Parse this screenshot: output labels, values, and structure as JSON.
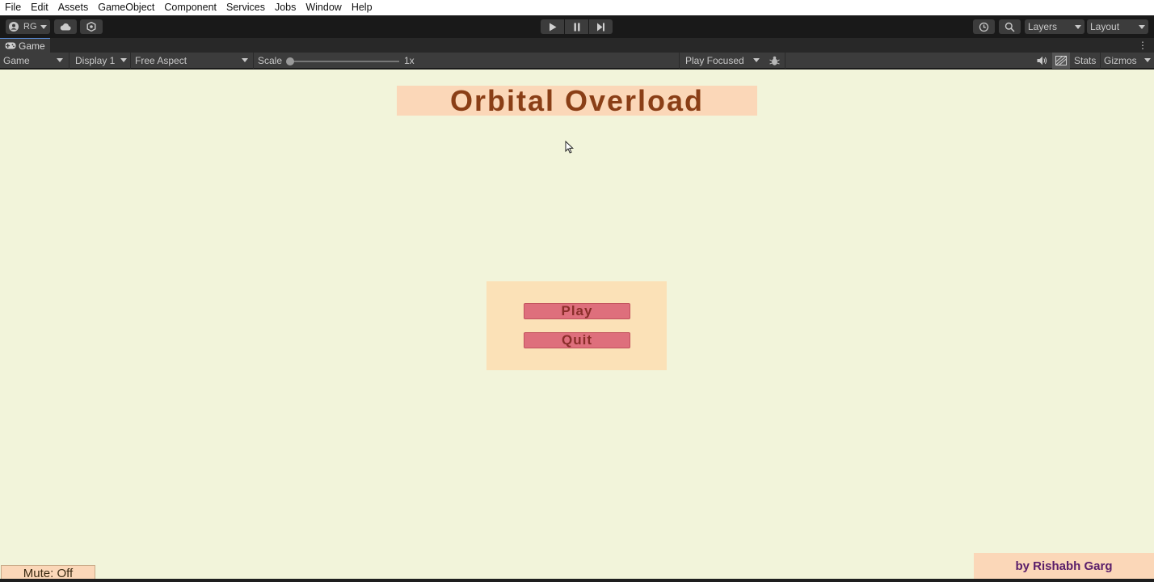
{
  "menu": {
    "items": [
      "File",
      "Edit",
      "Assets",
      "GameObject",
      "Component",
      "Services",
      "Jobs",
      "Window",
      "Help"
    ]
  },
  "toolbar": {
    "account_label": "RG",
    "layers_label": "Layers",
    "layout_label": "Layout",
    "icons": [
      "account-icon",
      "cloud-icon",
      "settings-icon",
      "play-icon",
      "pause-icon",
      "step-icon",
      "history-icon",
      "search-icon"
    ]
  },
  "tab": {
    "label": "Game"
  },
  "game_toolbar": {
    "view_mode": "Game",
    "display": "Display 1",
    "aspect": "Free Aspect",
    "scale_label": "Scale",
    "scale_value": "1x",
    "play_mode": "Play Focused",
    "stats_label": "Stats",
    "gizmos_label": "Gizmos"
  },
  "game": {
    "title": "Orbital Overload",
    "play_label": "Play",
    "quit_label": "Quit",
    "mute_label": "Mute: Off",
    "credit": "by Rishabh Garg"
  },
  "colors": {
    "viewport_bg": "#f2f4da",
    "title_color": "#8a3e16",
    "button_fill": "#de6f7c",
    "credit_color": "#5a1e6a"
  }
}
